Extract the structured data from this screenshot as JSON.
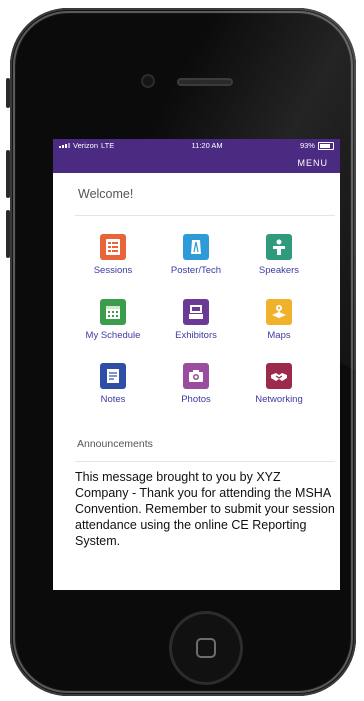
{
  "status_bar": {
    "carrier": "Verizon",
    "network": "LTE",
    "time": "11:20 AM",
    "battery": "93%"
  },
  "app_bar": {
    "menu_label": "MENU"
  },
  "welcome_text": "Welcome!",
  "tiles": [
    {
      "label": "Sessions",
      "icon": "sessions-icon",
      "color": "#e8643a"
    },
    {
      "label": "Poster/Tech",
      "icon": "poster-tech-icon",
      "color": "#2e9ad8"
    },
    {
      "label": "Speakers",
      "icon": "speakers-icon",
      "color": "#2f9a7c"
    },
    {
      "label": "My Schedule",
      "icon": "schedule-icon",
      "color": "#3b9d4c"
    },
    {
      "label": "Exhibitors",
      "icon": "exhibitors-icon",
      "color": "#6a3a96"
    },
    {
      "label": "Maps",
      "icon": "maps-icon",
      "color": "#f0b22b"
    },
    {
      "label": "Notes",
      "icon": "notes-icon",
      "color": "#2f4ea6"
    },
    {
      "label": "Photos",
      "icon": "photos-icon",
      "color": "#9a4c9e"
    },
    {
      "label": "Networking",
      "icon": "networking-icon",
      "color": "#9b2a4d"
    }
  ],
  "announcements": {
    "heading": "Announcements",
    "message": "This message brought to you by XYZ Company - Thank you for attending the MSHA Convention. Remember to submit your session attendance using the online CE Reporting System."
  },
  "colors": {
    "brand": "#4b2a82",
    "link": "#3e3aa0"
  }
}
